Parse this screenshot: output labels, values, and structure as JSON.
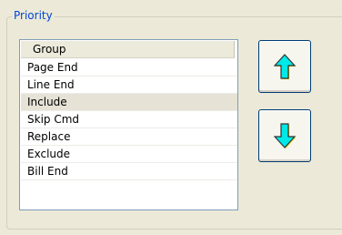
{
  "priority": {
    "title": "Priority",
    "list": {
      "header": "Group",
      "items": [
        "Page End",
        "Line End",
        "Include",
        "Skip Cmd",
        "Replace",
        "Exclude",
        "Bill End"
      ],
      "selected_index": 2
    },
    "buttons": {
      "up_icon": "arrow-up-icon",
      "down_icon": "arrow-down-icon"
    }
  },
  "colors": {
    "title_blue": "#0046d5",
    "arrow_fill": "#00e8e8",
    "arrow_stroke": "#333333",
    "arrow_shadow": "#d8d000"
  }
}
